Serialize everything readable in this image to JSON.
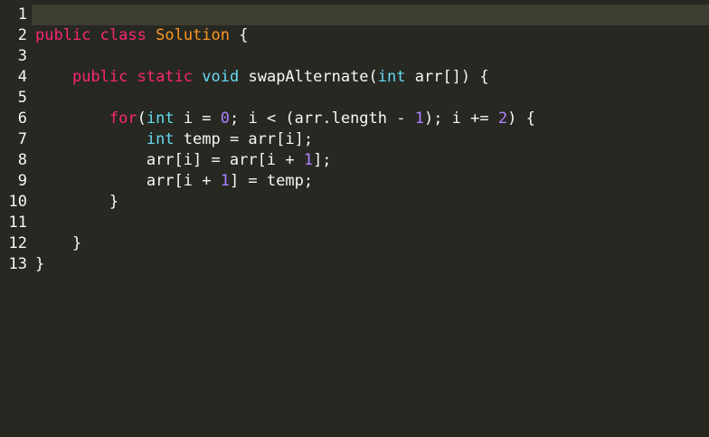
{
  "colors": {
    "background": "#272822",
    "active_line": "#3e3d32",
    "keyword": "#f92672",
    "class_name": "#fd971f",
    "type": "#66d9ef",
    "number": "#ae81ff",
    "text": "#f8f8f2"
  },
  "editor": {
    "active_line": 1,
    "lines": [
      {
        "num": "1",
        "tokens": []
      },
      {
        "num": "2",
        "tokens": [
          {
            "t": "public",
            "c": "kw"
          },
          {
            "t": " ",
            "c": "id"
          },
          {
            "t": "class",
            "c": "kw"
          },
          {
            "t": " ",
            "c": "id"
          },
          {
            "t": "Solution",
            "c": "cls"
          },
          {
            "t": " {",
            "c": "id"
          }
        ]
      },
      {
        "num": "3",
        "tokens": []
      },
      {
        "num": "4",
        "tokens": [
          {
            "t": "    ",
            "c": "id"
          },
          {
            "t": "public",
            "c": "kw"
          },
          {
            "t": " ",
            "c": "id"
          },
          {
            "t": "static",
            "c": "kw"
          },
          {
            "t": " ",
            "c": "id"
          },
          {
            "t": "void",
            "c": "typ"
          },
          {
            "t": " swapAlternate(",
            "c": "id"
          },
          {
            "t": "int",
            "c": "typ"
          },
          {
            "t": " arr[]) {",
            "c": "id"
          }
        ]
      },
      {
        "num": "5",
        "tokens": []
      },
      {
        "num": "6",
        "tokens": [
          {
            "t": "        ",
            "c": "id"
          },
          {
            "t": "for",
            "c": "kw"
          },
          {
            "t": "(",
            "c": "id"
          },
          {
            "t": "int",
            "c": "typ"
          },
          {
            "t": " i = ",
            "c": "id"
          },
          {
            "t": "0",
            "c": "num"
          },
          {
            "t": "; i < (arr.length - ",
            "c": "id"
          },
          {
            "t": "1",
            "c": "num"
          },
          {
            "t": "); i += ",
            "c": "id"
          },
          {
            "t": "2",
            "c": "num"
          },
          {
            "t": ") {",
            "c": "id"
          }
        ]
      },
      {
        "num": "7",
        "tokens": [
          {
            "t": "            ",
            "c": "id"
          },
          {
            "t": "int",
            "c": "typ"
          },
          {
            "t": " temp = arr[i];",
            "c": "id"
          }
        ]
      },
      {
        "num": "8",
        "tokens": [
          {
            "t": "            arr[i] = arr[i + ",
            "c": "id"
          },
          {
            "t": "1",
            "c": "num"
          },
          {
            "t": "];",
            "c": "id"
          }
        ]
      },
      {
        "num": "9",
        "tokens": [
          {
            "t": "            arr[i + ",
            "c": "id"
          },
          {
            "t": "1",
            "c": "num"
          },
          {
            "t": "] = temp;",
            "c": "id"
          }
        ]
      },
      {
        "num": "10",
        "tokens": [
          {
            "t": "        }",
            "c": "id"
          }
        ]
      },
      {
        "num": "11",
        "tokens": []
      },
      {
        "num": "12",
        "tokens": [
          {
            "t": "    }",
            "c": "id"
          }
        ]
      },
      {
        "num": "13",
        "tokens": [
          {
            "t": "}",
            "c": "id"
          }
        ]
      }
    ]
  }
}
